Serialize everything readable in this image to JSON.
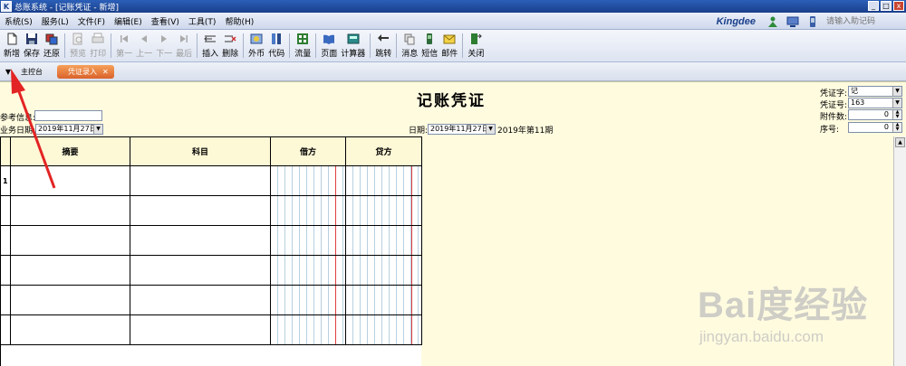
{
  "window": {
    "app_icon": "K",
    "title": "总账系统 - [记账凭证 - 新增]",
    "controls": [
      "_",
      "□",
      "x"
    ]
  },
  "menu": {
    "items": [
      "系统(S)",
      "服务(L)",
      "文件(F)",
      "编辑(E)",
      "查看(V)",
      "工具(T)",
      "帮助(H)"
    ],
    "brand": "Kingdee",
    "helper_placeholder": "请输入助记码"
  },
  "toolbar": {
    "buttons": [
      {
        "label": "新增",
        "icon": "new-doc-icon",
        "enabled": true
      },
      {
        "label": "保存",
        "icon": "save-icon",
        "enabled": true
      },
      {
        "label": "还原",
        "icon": "restore-icon",
        "enabled": true
      },
      {
        "label": "预览",
        "icon": "preview-icon",
        "enabled": false
      },
      {
        "label": "打印",
        "icon": "print-icon",
        "enabled": false
      },
      {
        "label": "第一",
        "icon": "first-icon",
        "enabled": false
      },
      {
        "label": "上一",
        "icon": "prev-icon",
        "enabled": false
      },
      {
        "label": "下一",
        "icon": "next-icon",
        "enabled": false
      },
      {
        "label": "最后",
        "icon": "last-icon",
        "enabled": false
      },
      {
        "label": "插入",
        "icon": "insert-icon",
        "enabled": true
      },
      {
        "label": "删除",
        "icon": "delete-icon",
        "enabled": true
      },
      {
        "label": "外币",
        "icon": "currency-icon",
        "enabled": true
      },
      {
        "label": "代码",
        "icon": "code-icon",
        "enabled": true
      },
      {
        "label": "流量",
        "icon": "flow-icon",
        "enabled": true
      },
      {
        "label": "页面",
        "icon": "page-icon",
        "enabled": true
      },
      {
        "label": "计算器",
        "icon": "calculator-icon",
        "enabled": true
      },
      {
        "label": "跳转",
        "icon": "jump-icon",
        "enabled": true
      },
      {
        "label": "消息",
        "icon": "message-icon",
        "enabled": true
      },
      {
        "label": "短信",
        "icon": "sms-icon",
        "enabled": true
      },
      {
        "label": "邮件",
        "icon": "mail-icon",
        "enabled": true
      },
      {
        "label": "关闭",
        "icon": "close-icon",
        "enabled": true
      }
    ]
  },
  "tabs": {
    "home": "主控台",
    "active": "凭证录入",
    "close_glyph": "✕",
    "arrow": "▼"
  },
  "voucher": {
    "title": "记账凭证",
    "ref_label": "参考信息:",
    "ref_value": "",
    "biz_date_label": "业务日期:",
    "biz_date_value": "2019年11月27日",
    "date_label": "日期:",
    "date_value": "2019年11月27日",
    "period_text": "2019年第11期",
    "voucher_word_label": "凭证字:",
    "voucher_word_value": "记",
    "voucher_no_label": "凭证号:",
    "voucher_no_value": "163",
    "attach_label": "附件数:",
    "attach_value": "0",
    "seq_label": "序号:",
    "seq_value": "0"
  },
  "grid": {
    "columns": [
      "摘要",
      "科目",
      "借方",
      "贷方"
    ],
    "first_row_number": "1",
    "row_count": 6
  },
  "colors": {
    "voucher_bg": "#fffbdf",
    "active_tab": "#e8742e",
    "annotation_arrow": "#e32424"
  },
  "watermark": {
    "main": "Bai度经验",
    "sub": "jingyan.baidu.com"
  }
}
